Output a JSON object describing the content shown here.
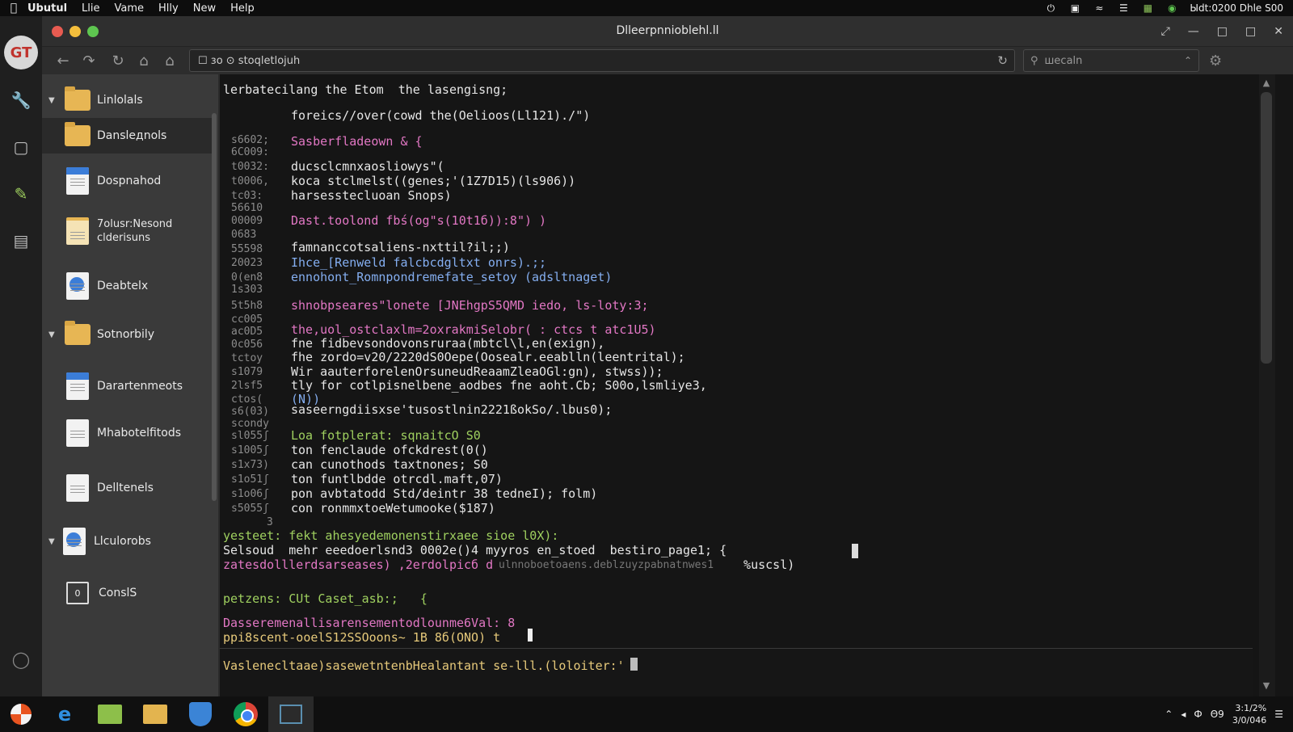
{
  "menubar": {
    "apple_icon": "apple-icon",
    "items": [
      "Ubutul",
      "Llie",
      "Vame",
      "Hlly",
      "New",
      "Help"
    ],
    "status_text": "Ыdt:0200 Dhle S00"
  },
  "window": {
    "title": "Dlleerpnnioblehl.ll"
  },
  "toolbar": {
    "address_value": "☐ зo  ⊙  stoqletlojuh",
    "search_placeholder": "шecaln"
  },
  "sidebar": {
    "items": [
      {
        "label": "Linlolals",
        "icon": "folder-icon"
      },
      {
        "label": "Danslедnols",
        "icon": "folder-icon"
      },
      {
        "label": "Dospnahod",
        "icon": "document-icon"
      },
      {
        "label": "7olusr:Nesond\nclderisuns",
        "icon": "folder-document-icon"
      },
      {
        "label": "Deabtelx",
        "icon": "document-icon"
      },
      {
        "label": "Sotnorbily",
        "icon": "folder-icon"
      },
      {
        "label": "Darartenmeots",
        "icon": "document-icon"
      },
      {
        "label": "Mhabotelfitods",
        "icon": "document-icon"
      },
      {
        "label": "Delltenels",
        "icon": "document-icon"
      },
      {
        "label": "Llculorobs",
        "icon": "document-icon"
      },
      {
        "label": "ConslS",
        "box": "0",
        "icon": "console-icon"
      }
    ]
  },
  "editor": {
    "header": "lerbatecilang the Etom  the lasengisng;",
    "lines": [
      {
        "gutter": "",
        "text": "foreics//over(cowd the(Oelioos(Ll121)./\")"
      },
      {
        "gutter": "s6602;\n6C009:",
        "text": "Sasberflаdеown & {"
      },
      {
        "gutter": "t0032:",
        "text": "ducsclcmnxaosliowys\"("
      },
      {
        "gutter": "t0006,",
        "text": "koca stclmelst((genes;'(1Z7D15)(ls906))"
      },
      {
        "gutter": "tc03:\n56610",
        "text": "harsesstecluоan Snops)"
      },
      {
        "gutter": "00009",
        "text": "Dast.toolond fbś(og\"s(10t1б)):8\") )"
      },
      {
        "gutter": "0683",
        "text": ""
      },
      {
        "gutter": "55598",
        "text": "famnanccotsаliens-nxttil?il;;)"
      },
      {
        "gutter": "20023",
        "text": "Ihce_[Renweld falcbcdgltxt onrs).;;"
      },
      {
        "gutter": "0(en8\n1s303",
        "text": "ennohont_Romnpondremefate_setoy (adsltnaget)"
      },
      {
        "gutter": "5t5h8",
        "text": "shnobpseares\"lonete [JNEhgpS5QMD iedo, ls-loty:3;"
      },
      {
        "gutter": "cc005",
        "text": ""
      },
      {
        "gutter": "ac0D5",
        "text": "the,uol_ostclaxlm=2oxrakmiSelobr( : ctcs t atc1U5)"
      },
      {
        "gutter": "0c056",
        "text": "fne fidbevsondovonsrurаa(mbtcl\\l,en(exign),"
      },
      {
        "gutter": "tctoy",
        "text": "fhe zordo=v20/2220dS0Оepe(Oosealr.eеablln(leentrital);"
      },
      {
        "gutter": "s1079",
        "text": "Wir aauterforelenOrsuneudReaamZleaOGl:gn), stwss));"
      },
      {
        "gutter": "2lsf5",
        "text": "tly for cotlpisnelbene_aodbes fne aoht.Cb; S00o,lsmliye3,"
      },
      {
        "gutter": "ctos(",
        "text": "(N))"
      },
      {
        "gutter": "s6(03)\nscondy",
        "text": "saseerngdiisxse'tusostlnin2221ßokSo/.lbus0);"
      },
      {
        "gutter": "sl055ʃ",
        "text": "Loa fotplerat: sqnaitcO S0"
      },
      {
        "gutter": "s1005ʃ",
        "text": "ton fenclaude ofckdrest(0()"
      },
      {
        "gutter": "s1x73)",
        "text": "can cunothods taxtnones; S0"
      },
      {
        "gutter": "s1o51ʃ",
        "text": "ton funtlbdde otrcdl.maft,07)"
      },
      {
        "gutter": "s1o06ʃ",
        "text": "pon avbtatodd Std/deintr 38 tedneI); folm)"
      },
      {
        "gutter": "s5055ʃ",
        "text": "con ronmmxtoeWetumooke($187)"
      },
      {
        "gutter": "3",
        "text": ""
      }
    ],
    "tail": [
      "yesteet: fekt ahesyedemonenstirxaee sioe l0X):",
      "Selsoud  mehr eeedoerlsnd3 0002e()4 myyros en_stoed  bestiro_page1; {",
      "zatesdolllerdsarseases) ,2erdolpicб d",
      "ulnnoboetoaens.deblzuyzpabnatnwes1",
      "  %uscsl)",
      "petzens: CUt Caset_asb:;   {",
      "Dasseremenallisarensementodlounme6Val: 8",
      "ppi8scent-ooelS12SSOoons~ 1B 8б(ONO) t",
      "Vaslenecltaae)sasewetntenbHealаntant se-lll.(loloiter:'"
    ]
  },
  "taskbar": {
    "apps": [
      "ubuntu-start-icon",
      "edge-icon",
      "file-manager-icon",
      "folder-icon",
      "shield-icon",
      "chrome-icon",
      "terminal-icon"
    ],
    "clock_line1": "3:1/2%",
    "clock_line2": "3/0/046"
  }
}
